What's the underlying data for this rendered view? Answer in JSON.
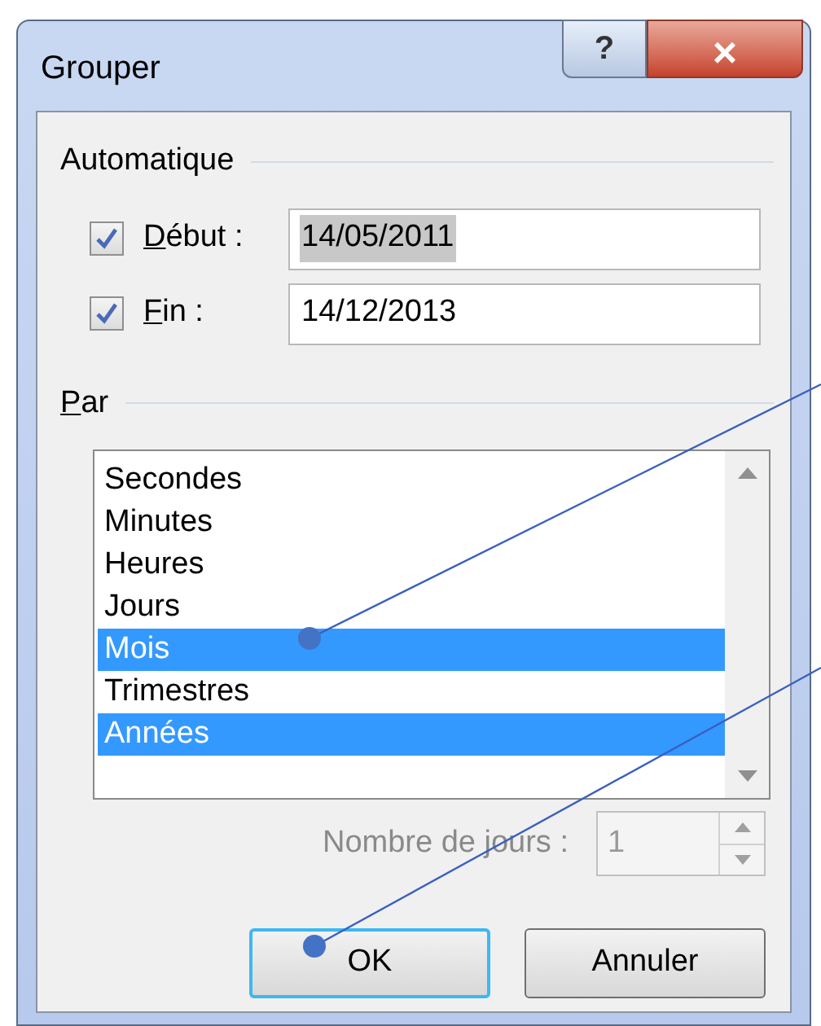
{
  "window": {
    "title": "Grouper",
    "help_button": "?",
    "close_button": "×"
  },
  "automatic": {
    "title": "Automatique",
    "fields": [
      {
        "label": "Début :",
        "underline_first": true,
        "checked": true,
        "value": "14/05/2011",
        "highlighted": true
      },
      {
        "label": "Fin :",
        "underline_first": true,
        "checked": true,
        "value": "14/12/2013",
        "highlighted": false
      }
    ]
  },
  "by": {
    "title": "Par",
    "underline_first": true,
    "items": [
      {
        "label": "Secondes",
        "selected": false
      },
      {
        "label": "Minutes",
        "selected": false
      },
      {
        "label": "Heures",
        "selected": false
      },
      {
        "label": "Jours",
        "selected": false
      },
      {
        "label": "Mois",
        "selected": true
      },
      {
        "label": "Trimestres",
        "selected": false
      },
      {
        "label": "Années",
        "selected": true
      }
    ]
  },
  "days": {
    "label": "Nombre de jours :",
    "value": "1",
    "disabled": true
  },
  "buttons": [
    {
      "label": "OK",
      "default": true
    },
    {
      "label": "Annuler",
      "default": false
    }
  ]
}
